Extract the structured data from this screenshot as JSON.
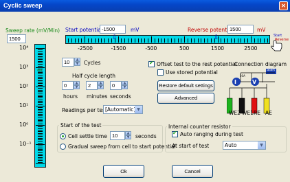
{
  "window": {
    "title": "Cyclic sweep",
    "close_glyph": "✕"
  },
  "sweep_rate": {
    "label": "Sweep rate (mV/Min)",
    "value": "1500",
    "ticks": [
      "10⁴",
      "10³",
      "10²",
      "10¹",
      "10⁰",
      "10⁻¹"
    ],
    "pointer": "⇨"
  },
  "potential_bar": {
    "start_label": "Start potential",
    "start_value": "-1500",
    "start_unit": "mV",
    "reverse_label": "Reverse potential",
    "reverse_value": "1500",
    "reverse_unit": "mV",
    "start_short": "Start",
    "reverse_short": "Reverse",
    "ticks": [
      "-2500",
      "-1500",
      "-500",
      "500",
      "1500",
      "2500"
    ]
  },
  "cycles": {
    "value": "10",
    "label": "Cycles"
  },
  "half_cycle": {
    "label": "Half cycle length",
    "hours": "0",
    "minutes": "2",
    "seconds": "0",
    "hours_label": "hours",
    "minutes_label": "minutes",
    "seconds_label": "seconds"
  },
  "readings": {
    "label": "Readings per test",
    "value": "[Automatic]"
  },
  "offset": {
    "label": "Offset test to the rest potential",
    "checked": true
  },
  "stored": {
    "label": "Use stored potential",
    "checked": false
  },
  "buttons": {
    "restore": "Restore default settings",
    "advanced": "Advanced",
    "ok": "Ok",
    "cancel": "Cancel"
  },
  "connection": {
    "title": "Connection diagram",
    "start_tag": "Start",
    "cell_switch": "cell",
    "current_symbol": "I",
    "voltage_symbol": "V",
    "resistor": "20A",
    "electrodes": [
      "WE2",
      "WE1",
      "RE",
      "AE"
    ],
    "colors": {
      "we2": "#1db31d",
      "we1": "#111111",
      "re": "#e01010",
      "ae": "#f0e020"
    },
    "we2_note": "Separate"
  },
  "start_of_test": {
    "label": "Start of the test",
    "settle_label": "Cell settle time",
    "settle_value": "10",
    "settle_unit": "seconds",
    "gradual_label": "Gradual sweep from cell to start potential"
  },
  "counter": {
    "label": "Internal counter resistor",
    "auto_label": "Auto ranging during test",
    "at_start_label": "At start of test",
    "at_start_value": "Auto"
  }
}
